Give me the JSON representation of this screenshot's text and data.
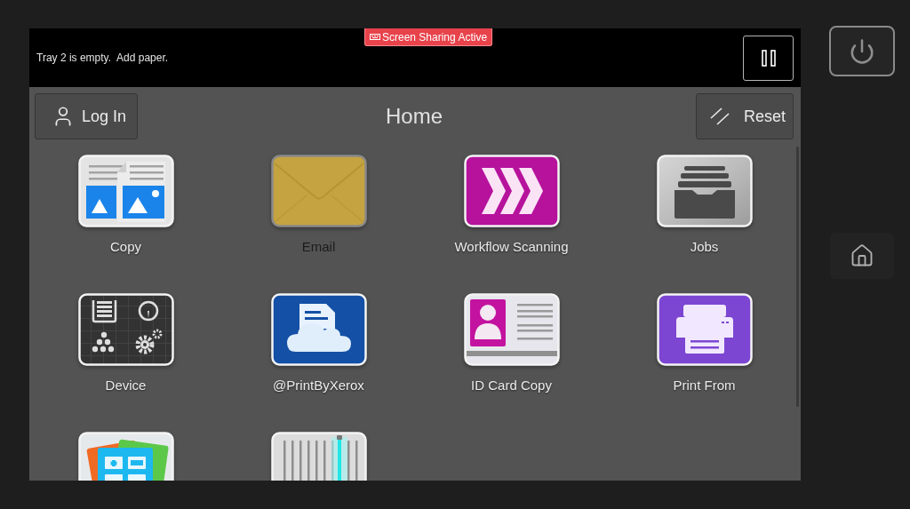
{
  "status_bar": {
    "message": "Tray 2 is empty.  Add paper.",
    "badge": "Screen Sharing Active"
  },
  "toolbar": {
    "login_button": "Log In",
    "title": "Home",
    "reset_button": "Reset"
  },
  "apps": [
    {
      "kind": "copy",
      "label": "Copy",
      "disabled": false
    },
    {
      "kind": "email",
      "label": "Email",
      "disabled": true
    },
    {
      "kind": "workflow",
      "label": "Workflow Scanning",
      "disabled": false
    },
    {
      "kind": "jobs",
      "label": "Jobs",
      "disabled": false
    },
    {
      "kind": "device",
      "label": "Device",
      "disabled": false
    },
    {
      "kind": "cloudprint",
      "label": "@PrintByXerox",
      "disabled": false
    },
    {
      "kind": "idcard",
      "label": "ID Card Copy",
      "disabled": false
    },
    {
      "kind": "printfrom",
      "label": "Print From",
      "disabled": false
    },
    {
      "kind": "gallery",
      "disabled": false
    },
    {
      "kind": "scanner",
      "disabled": false
    }
  ]
}
